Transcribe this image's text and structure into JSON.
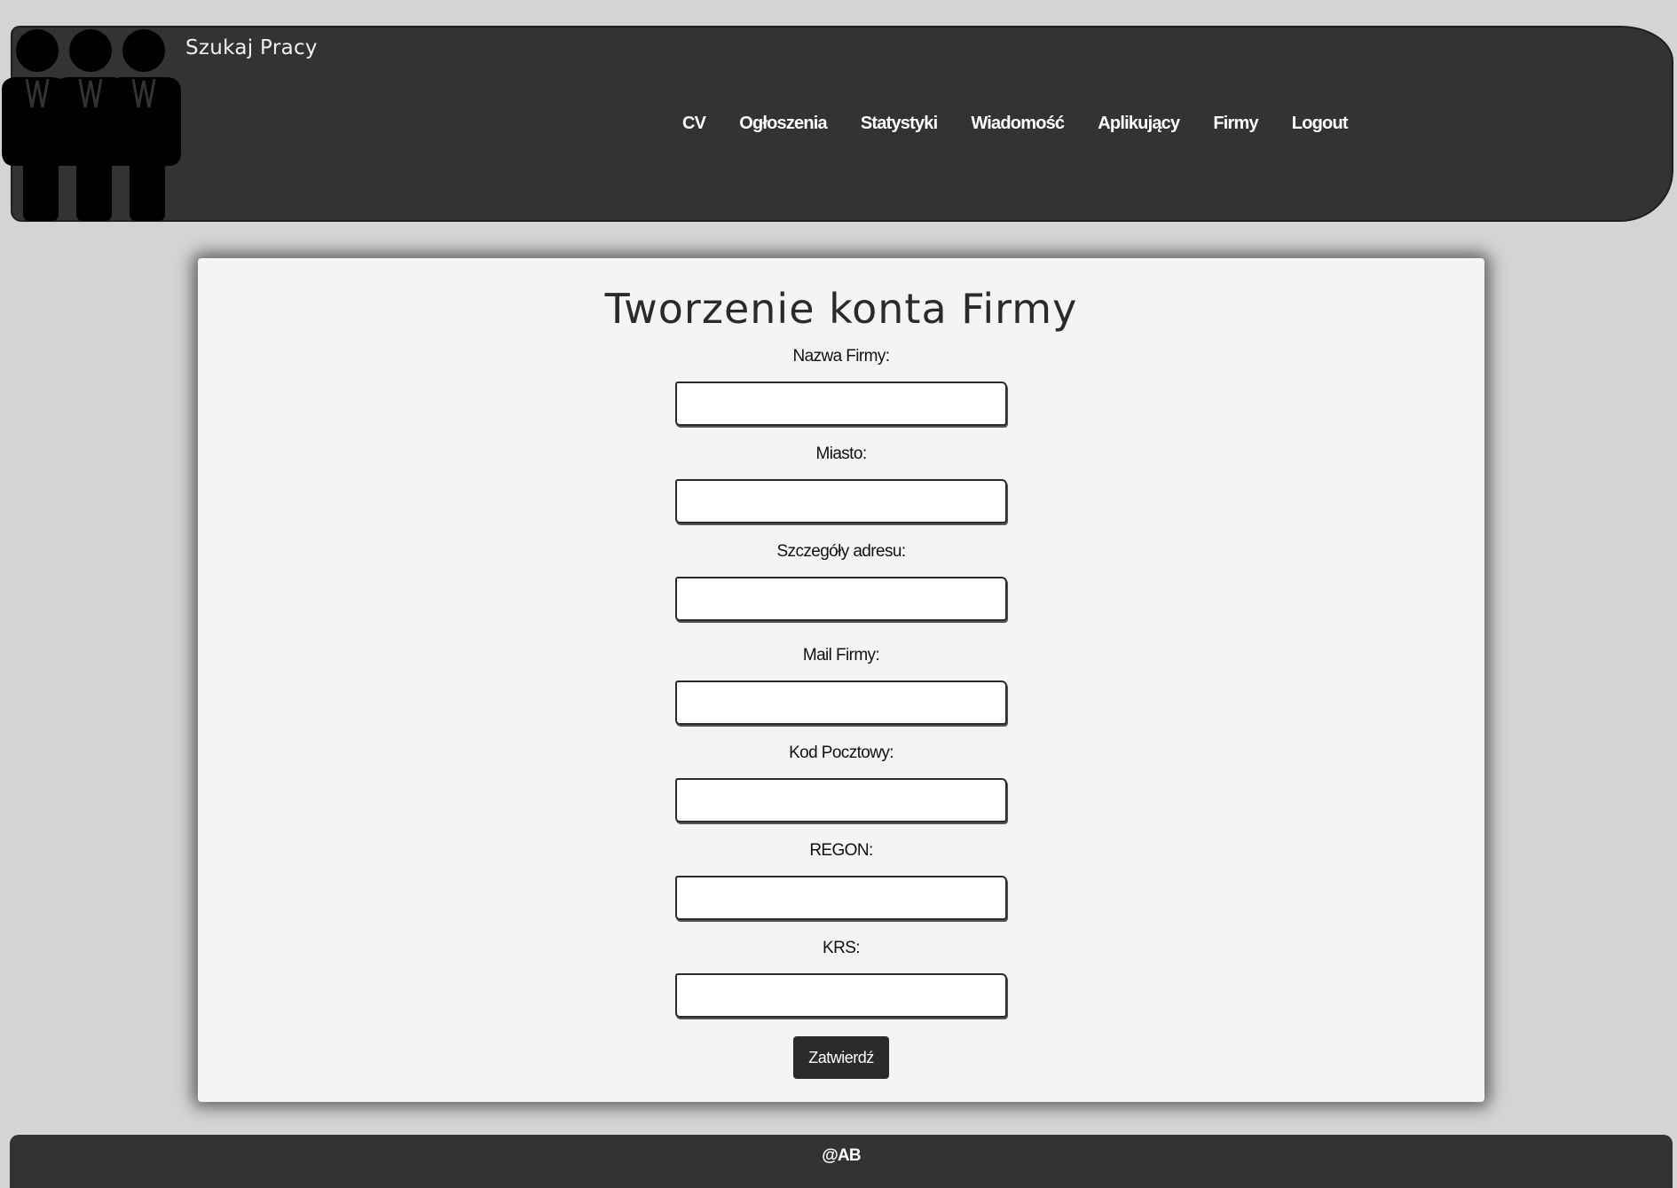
{
  "header": {
    "site_title": "Szukaj Pracy",
    "logo_icon": "people-group-icon",
    "nav": [
      {
        "label": "CV"
      },
      {
        "label": "Ogłoszenia"
      },
      {
        "label": "Statystyki"
      },
      {
        "label": "Wiadomość"
      },
      {
        "label": "Aplikujący"
      },
      {
        "label": "Firmy"
      },
      {
        "label": "Logout"
      }
    ]
  },
  "form": {
    "title": "Tworzenie konta Firmy",
    "fields": [
      {
        "label": "Nazwa Firmy:",
        "value": "",
        "placeholder": ""
      },
      {
        "label": "Miasto:",
        "value": "",
        "placeholder": ""
      },
      {
        "label": "Szczegóły adresu:",
        "value": "",
        "placeholder": ""
      },
      {
        "label": "Mail Firmy:",
        "value": "",
        "placeholder": ""
      },
      {
        "label": "Kod Pocztowy:",
        "value": "",
        "placeholder": ""
      },
      {
        "label": "REGON:",
        "value": "",
        "placeholder": ""
      },
      {
        "label": "KRS:",
        "value": "",
        "placeholder": ""
      }
    ],
    "submit_label": "Zatwierdź"
  },
  "footer": {
    "text": "@AB"
  },
  "colors": {
    "page_background": "#d4d4d4",
    "bar_background": "#333333",
    "card_background": "#f4f4f4",
    "button_background": "#2b2b2b"
  }
}
